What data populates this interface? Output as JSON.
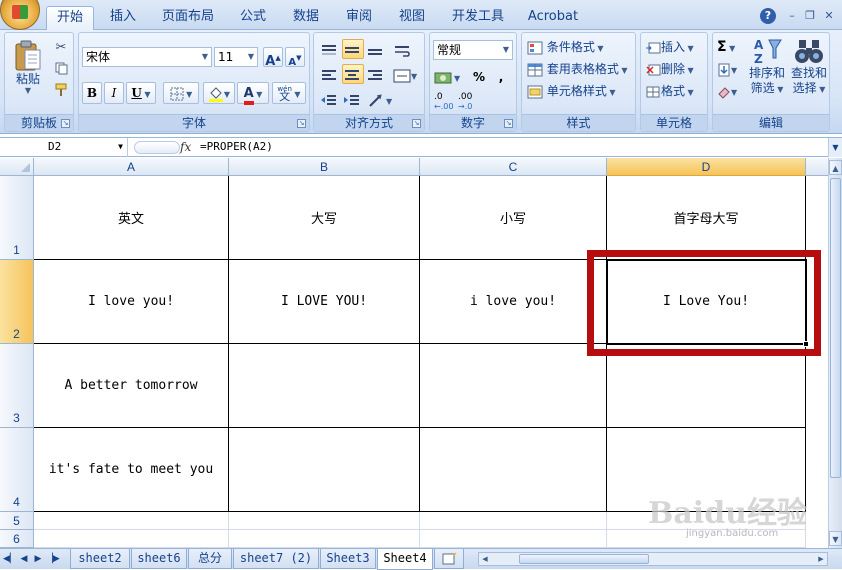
{
  "ribbon": {
    "tabs": [
      "开始",
      "插入",
      "页面布局",
      "公式",
      "数据",
      "审阅",
      "视图",
      "开发工具",
      "Acrobat"
    ],
    "active_tab": "开始",
    "clipboard": {
      "paste_label": "粘贴",
      "group_label": "剪贴板"
    },
    "font": {
      "name": "宋体",
      "size": "11",
      "bold": "B",
      "italic": "I",
      "underline": "U",
      "font_color_glyph": "A",
      "phonetic_glyph": "wén",
      "phonetic_char": "文",
      "grow": "A",
      "shrink": "A",
      "group_label": "字体"
    },
    "alignment": {
      "group_label": "对齐方式"
    },
    "number": {
      "format": "常规",
      "percent": "%",
      "comma": ",",
      "inc_decimal": ".0",
      "dec_decimal": ".00",
      "group_label": "数字"
    },
    "styles": {
      "conditional": "条件格式",
      "table": "套用表格格式",
      "cell": "单元格样式",
      "group_label": "样式"
    },
    "cells": {
      "insert": "插入",
      "delete": "删除",
      "format": "格式",
      "group_label": "单元格"
    },
    "editing": {
      "sum": "Σ",
      "sort_line1": "排序和",
      "sort_line2": "筛选",
      "find_line1": "查找和",
      "find_line2": "选择",
      "group_label": "编辑"
    }
  },
  "formula_bar": {
    "name_box": "D2",
    "fx": "fx",
    "formula": "=PROPER(A2)"
  },
  "columns": [
    "A",
    "B",
    "C",
    "D"
  ],
  "selected_column": "D",
  "rows": [
    "1",
    "2",
    "3",
    "4",
    "5",
    "6"
  ],
  "selected_row": "2",
  "cells": {
    "A1": "英文",
    "B1": "大写",
    "C1": "小写",
    "D1": "首字母大写",
    "A2": "I love you!",
    "B2": "I LOVE YOU!",
    "C2": "i love you!",
    "D2": "I Love You!",
    "A3": "A better tomorrow",
    "A4": "it's fate to meet you"
  },
  "sheets": [
    "sheet2",
    "sheet6",
    "总分",
    "sheet7 (2)",
    "Sheet3",
    "Sheet4"
  ],
  "active_sheet": "Sheet4",
  "watermark": {
    "logo": "Baidu经验",
    "url": "jingyan.baidu.com"
  },
  "colors": {
    "highlight": "#b60e0e",
    "ribbon": "#dbe7f7",
    "header_selected": "#f5c35a"
  }
}
